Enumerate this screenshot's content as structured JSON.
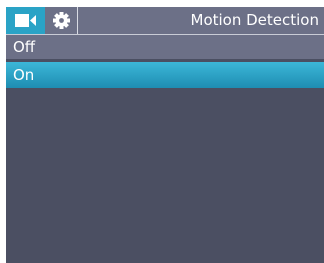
{
  "header": {
    "title": "Motion Detection",
    "tabs": [
      {
        "icon": "video-camera-icon",
        "active": true
      },
      {
        "icon": "gear-icon",
        "active": false
      }
    ]
  },
  "menu": {
    "items": [
      {
        "label": "Off",
        "selected": false
      },
      {
        "label": "On",
        "selected": true
      }
    ]
  },
  "colors": {
    "accent": "#2aa3c6",
    "background": "#4b4f62",
    "header": "#6c7087",
    "text": "#ffffff"
  }
}
